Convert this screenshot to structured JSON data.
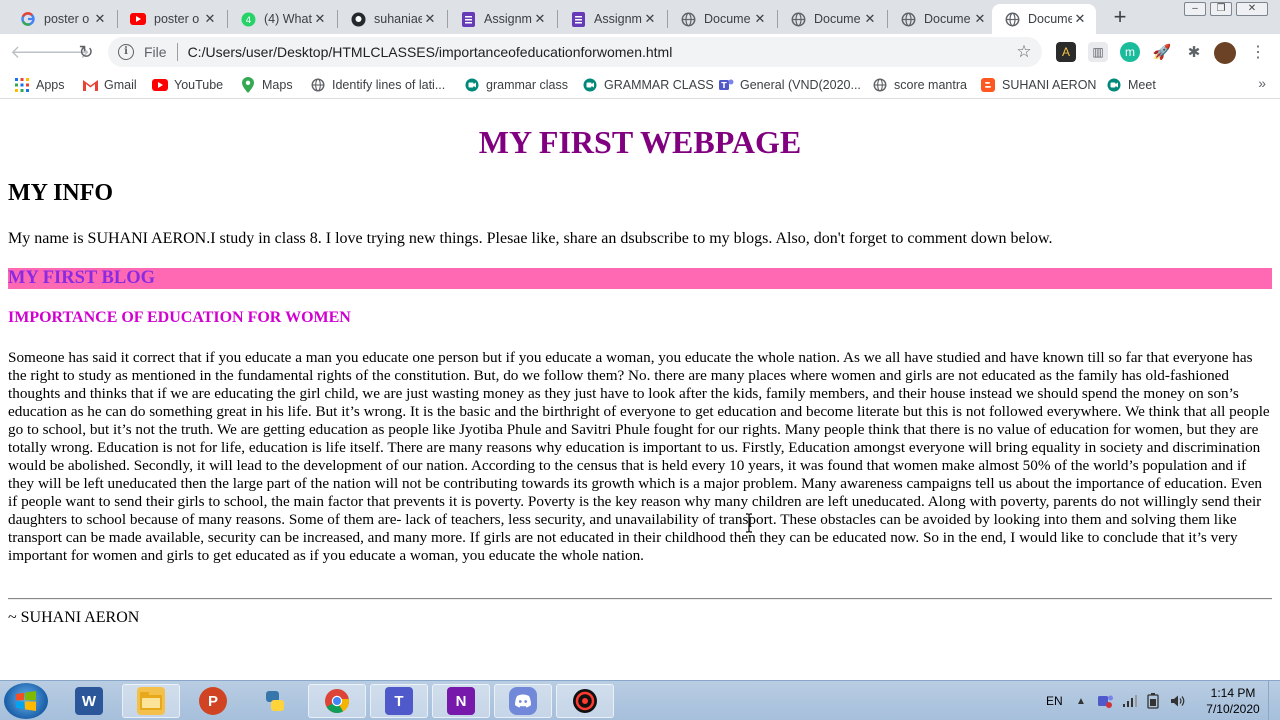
{
  "browser": {
    "tabs": [
      {
        "title": "poster o",
        "icon": "google-icon"
      },
      {
        "title": "poster o",
        "icon": "youtube-icon"
      },
      {
        "title": "(4) What",
        "icon": "whatsapp-icon"
      },
      {
        "title": "suhaniae",
        "icon": "github-icon"
      },
      {
        "title": "Assignm",
        "icon": "forms-icon"
      },
      {
        "title": "Assignm",
        "icon": "forms-icon"
      },
      {
        "title": "Docume",
        "icon": "globe-icon"
      },
      {
        "title": "Docume",
        "icon": "globe-icon"
      },
      {
        "title": "Docume",
        "icon": "globe-icon"
      },
      {
        "title": "Docume",
        "icon": "globe-icon",
        "active": true
      }
    ],
    "address": {
      "scheme_label": "File",
      "url": "C:/Users/user/Desktop/HTMLCLASSES/importanceofeducationforwomen.html"
    },
    "bookmarks": [
      {
        "label": "Apps",
        "icon": "apps-grid-icon"
      },
      {
        "label": "Gmail",
        "icon": "gmail-icon"
      },
      {
        "label": "YouTube",
        "icon": "youtube-icon"
      },
      {
        "label": "Maps",
        "icon": "maps-icon"
      },
      {
        "label": "Identify lines of lati...",
        "icon": "globe-icon"
      },
      {
        "label": "grammar class",
        "icon": "meet-icon"
      },
      {
        "label": "GRAMMAR CLASS",
        "icon": "meet-icon"
      },
      {
        "label": "General (VND(2020...",
        "icon": "teams-icon"
      },
      {
        "label": "score mantra",
        "icon": "globe-icon"
      },
      {
        "label": "SUHANI AERON",
        "icon": "blogger-icon"
      },
      {
        "label": "Meet",
        "icon": "meet-icon"
      }
    ]
  },
  "page": {
    "title": "MY FIRST WEBPAGE",
    "info_heading": "MY INFO",
    "intro": "My name is SUHANI AERON.I study in class 8. I love trying new things. Plesae like, share an dsubscribe to my blogs. Also, don't forget to comment down below.",
    "blog_heading": "MY FIRST BLOG",
    "blog_title": "IMPORTANCE OF EDUCATION FOR WOMEN",
    "essay": "Someone has said it correct that if you educate a man you educate one person but if you educate a woman, you educate the whole nation. As we all have studied and have known till so far that everyone has the right to study as mentioned in the fundamental rights of the constitution. But, do we follow them? No. there are many places where women and girls are not educated as the family has old-fashioned thoughts and thinks that if we are educating the girl child, we are just wasting money as they just have to look after the kids, family members, and their house instead we should spend the money on son’s education as he can do something great in his life. But it’s wrong. It is the basic and the birthright of everyone to get education and become literate but this is not followed everywhere. We think that all people go to school, but it’s not the truth. We are getting education as people like Jyotiba Phule and Savitri Phule fought for our rights. Many people think that there is no value of education for women, but they are totally wrong. Education is not for life, education is life itself. There are many reasons why education is important to us. Firstly, Education amongst everyone will bring equality in society and discrimination would be abolished. Secondly, it will lead to the development of our nation. According to the census that is held every 10 years, it was found that women make almost 50% of the world’s population and if they will be left uneducated then the large part of the nation will not be contributing towards its growth which is a major problem. Many awareness campaigns tell us about the importance of education. Even if people want to send their girls to school, the main factor that prevents it is poverty. Poverty is the key reason why many children are left uneducated. Along with poverty, parents do not willingly send their daughters to school because of many reasons. Some of them are- lack of teachers, less security, and unavailability of transport. These obstacles can be avoided by looking into them and solving them like transport can be made available, security can be increased, and many more. If girls are not educated in their childhood then they can be educated now. So in the end, I would like to conclude that it’s very important for women and girls to get educated as if you educate a woman, you educate the whole nation.",
    "signature": "~ SUHANI AERON"
  },
  "taskbar": {
    "apps": [
      {
        "name": "word-icon"
      },
      {
        "name": "file-explorer-icon"
      },
      {
        "name": "powerpoint-icon"
      },
      {
        "name": "python-icon"
      },
      {
        "name": "chrome-icon"
      },
      {
        "name": "teams-icon"
      },
      {
        "name": "onenote-icon"
      },
      {
        "name": "discord-icon"
      },
      {
        "name": "recorder-icon"
      }
    ],
    "language": "EN",
    "time": "1:14 PM",
    "date": "7/10/2020"
  },
  "colors": {
    "heading_purple": "#800080",
    "blog_bar_pink": "#ff69b4",
    "blog_text_violet": "#8a2be2",
    "subheading_magenta": "#d100d1"
  }
}
